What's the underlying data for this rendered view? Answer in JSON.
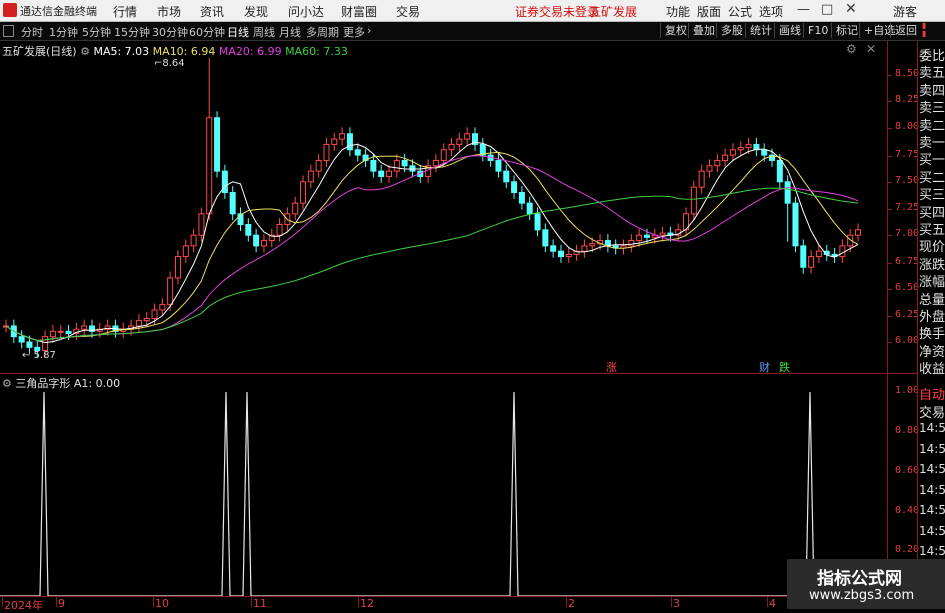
{
  "app": {
    "name": "通达信金融终端"
  },
  "menu": [
    "行情",
    "市场",
    "资讯",
    "发现",
    "问小达",
    "财富圈",
    "交易"
  ],
  "alerts": {
    "trade_warning": "证券交易未登录",
    "stock_name_red": "五矿发展"
  },
  "menu_right": [
    "功能",
    "版面",
    "公式",
    "选项"
  ],
  "user": "游客",
  "periods": [
    {
      "label": "分时",
      "active": false
    },
    {
      "label": "1分钟",
      "active": false
    },
    {
      "label": "5分钟",
      "active": false
    },
    {
      "label": "15分钟",
      "active": false
    },
    {
      "label": "30分钟",
      "active": false
    },
    {
      "label": "60分钟",
      "active": false
    },
    {
      "label": "日线",
      "active": true
    },
    {
      "label": "周线",
      "active": false
    },
    {
      "label": "月线",
      "active": false
    },
    {
      "label": "多周期",
      "active": false
    },
    {
      "label": "更多",
      "active": false
    }
  ],
  "toolbar_right": [
    "复权",
    "叠加",
    "多股",
    "统计",
    "画线",
    "F10",
    "标记",
    "+自选",
    "返回"
  ],
  "main_chart": {
    "title": "五矿发展(日线)",
    "ma": [
      {
        "label": "MA5: 7.03",
        "color": "#ffffff"
      },
      {
        "label": "MA10: 6.94",
        "color": "#f0e060"
      },
      {
        "label": "MA20: 6.99",
        "color": "#e040e0"
      },
      {
        "label": "MA60: 7.33",
        "color": "#40d040"
      }
    ],
    "y_ticks": [
      "8.50",
      "8.25",
      "8.00",
      "7.75",
      "7.50",
      "7.25",
      "7.00",
      "6.75",
      "6.50",
      "6.25",
      "6.00"
    ],
    "high_label": "8.64",
    "low_label": "5.87",
    "markers": [
      {
        "text": "涨",
        "color": "#ff4040"
      },
      {
        "text": "财",
        "color": "#5aa0ff"
      },
      {
        "text": "跌",
        "color": "#40e040"
      }
    ]
  },
  "indicator": {
    "title": "三角品字形",
    "value": "A1: 0.00",
    "y_ticks": [
      "1.00",
      "0.80",
      "0.60",
      "0.40",
      "0.20"
    ]
  },
  "x_axis": [
    "2024年",
    "9",
    "10",
    "11",
    "12",
    "2",
    "3",
    "4"
  ],
  "side_panel": {
    "labels": [
      "委比",
      "卖五",
      "卖四",
      "卖三",
      "卖二",
      "卖一",
      "买一",
      "买二",
      "买三",
      "买四",
      "买五",
      "现价",
      "涨跌",
      "涨幅",
      "总量",
      "外盘",
      "换手",
      "净资",
      "收益"
    ],
    "bottom": [
      "自动",
      "交易"
    ],
    "times": [
      "14:56",
      "14:56",
      "14:56",
      "14:56",
      "14:56",
      "14:56",
      "14:56",
      "14:56"
    ]
  },
  "watermark": {
    "line1": "指标公式网",
    "line2": "www.zbgs3.com"
  }
}
